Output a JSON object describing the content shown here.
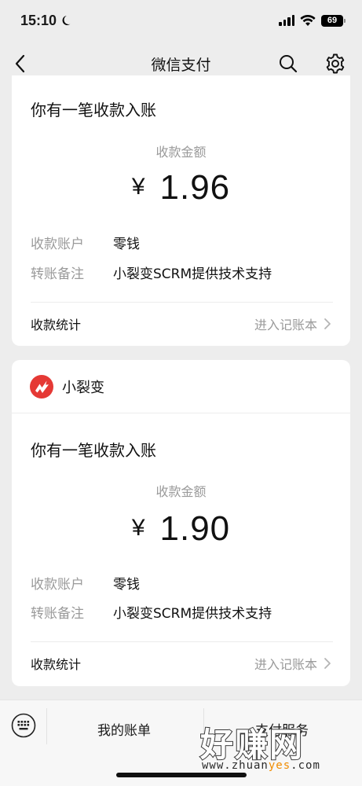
{
  "status_bar": {
    "time": "15:10",
    "battery": "69",
    "moon_icon": "moon-icon",
    "signal_icon": "signal-icon",
    "wifi_icon": "wifi-icon"
  },
  "nav": {
    "title": "微信支付",
    "back_icon": "chevron-left-icon",
    "search_icon": "search-icon",
    "settings_icon": "gear-icon"
  },
  "cards": [
    {
      "message_title": "你有一笔收款入账",
      "amount_label": "收款金额",
      "currency": "¥",
      "amount": "1.96",
      "rows": [
        {
          "label": "收款账户",
          "value": "零钱"
        },
        {
          "label": "转账备注",
          "value": "小裂变SCRM提供技术支持"
        }
      ],
      "footer_left": "收款统计",
      "footer_right": "进入记账本"
    },
    {
      "brand_name": "小裂变",
      "message_title": "你有一笔收款入账",
      "amount_label": "收款金额",
      "currency": "¥",
      "amount": "1.90",
      "rows": [
        {
          "label": "收款账户",
          "value": "零钱"
        },
        {
          "label": "转账备注",
          "value": "小裂变SCRM提供技术支持"
        }
      ],
      "footer_left": "收款统计",
      "footer_right": "进入记账本"
    }
  ],
  "bottom_bar": {
    "keyboard_icon": "keyboard-icon",
    "item_1": "我的账单",
    "item_2": "支付服务"
  },
  "watermark": {
    "main": "好赚网",
    "sub_prefix": "www.zhuan",
    "sub_highlight": "yes",
    "sub_suffix": ".com"
  },
  "colors": {
    "background": "#ededed",
    "card": "#ffffff",
    "brand_red": "#e53935",
    "muted_text": "#9a9a9a",
    "watermark_orange": "#f08c00"
  }
}
